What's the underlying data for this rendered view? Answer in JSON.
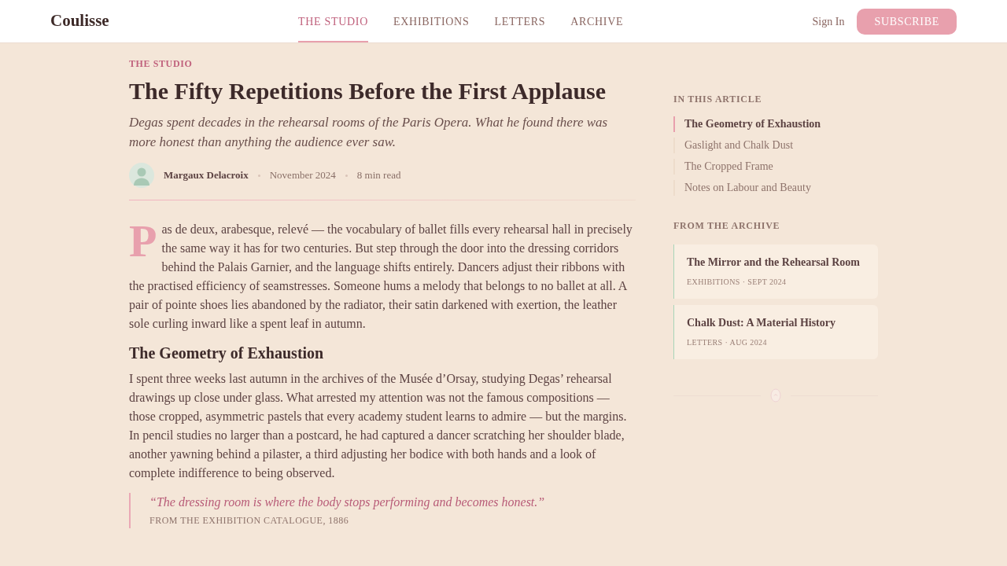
{
  "header": {
    "logo": "Coulisse",
    "nav": [
      {
        "label": "THE STUDIO",
        "selected": true
      },
      {
        "label": "EXHIBITIONS",
        "selected": false
      },
      {
        "label": "LETTERS",
        "selected": false
      },
      {
        "label": "ARCHIVE",
        "selected": false
      }
    ],
    "sign_in": "Sign In",
    "subscribe": "SUBSCRIBE"
  },
  "article": {
    "kicker": "THE STUDIO",
    "title": "The Fifty Repetitions Before the First Applause",
    "standfirst": "Degas spent decades in the rehearsal rooms of the Paris Opera. What he found there was more honest than anything the audience ever saw.",
    "byline": {
      "author": "Margaux Delacroix",
      "date": "November 2024",
      "read_time": "8 min read"
    },
    "body": [
      {
        "kind": "lead",
        "drop_cap": "P",
        "text": "as de deux, arabesque, relevé — the vocabulary of ballet fills every rehearsal hall in precisely the same way it has for two centuries. But step through the door into the dressing corridors behind the Palais Garnier, and the language shifts entirely. Dancers adjust their ribbons with the practised efficiency of seamstresses. Someone hums a melody that belongs to no ballet at all. A pair of pointe shoes lies abandoned by the radiator, their satin darkened with exertion, the leather sole curling inward like a spent leaf in autumn."
      },
      {
        "kind": "heading",
        "text": "The Geometry of Exhaustion"
      },
      {
        "kind": "paragraph",
        "text": "I spent three weeks last autumn in the archives of the Musée d’Orsay, studying Degas’ rehearsal drawings up close under glass. What arrested my attention was not the famous compositions — those cropped, asymmetric pastels that every academy student learns to admire — but the margins. In pencil studies no larger than a postcard, he had captured a dancer scratching her shoulder blade, another yawning behind a pilaster, a third adjusting her bodice with both hands and a look of complete indifference to being observed."
      },
      {
        "kind": "quote",
        "text": "“The dressing room is where the body stops performing and becomes honest.”",
        "source": "FROM THE EXHIBITION CATALOGUE, 1886"
      }
    ]
  },
  "sidebar": {
    "toc": {
      "heading": "IN THIS ARTICLE",
      "items": [
        {
          "label": "The Geometry of Exhaustion",
          "selected": true
        },
        {
          "label": "Gaslight and Chalk Dust",
          "selected": false
        },
        {
          "label": "The Cropped Frame",
          "selected": false
        },
        {
          "label": "Notes on Labour and Beauty",
          "selected": false
        }
      ]
    },
    "archive": {
      "heading": "FROM THE ARCHIVE",
      "cards": [
        {
          "title": "The Mirror and the Rehearsal Room",
          "meta": "EXHIBITIONS · SEPT 2024"
        },
        {
          "title": "Chalk Dust: A Material History",
          "meta": "LETTERS · AUG 2024"
        }
      ]
    }
  }
}
